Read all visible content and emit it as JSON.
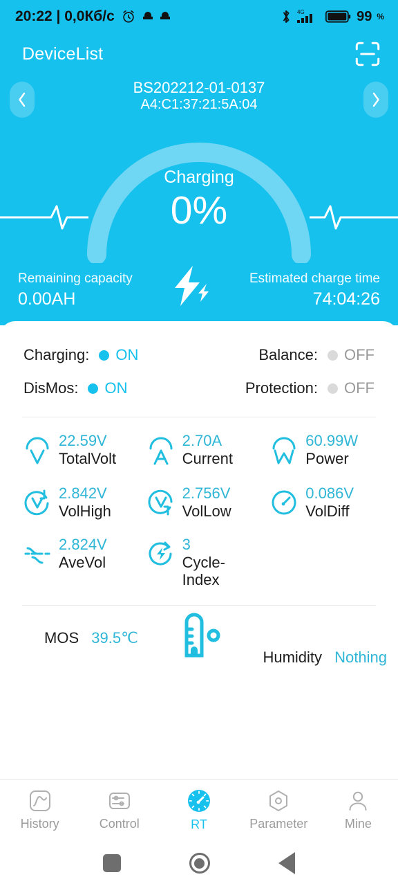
{
  "statusbar": {
    "clock": "20:22 | 0,0Кб/c",
    "alarm_icon": "alarm-clock-icon",
    "app_icon_1": "app-icon",
    "app_icon_2": "app-icon",
    "bluetooth_icon": "bluetooth-icon",
    "network_type": "4G",
    "signal_icon": "cellular-signal-icon",
    "battery_icon": "battery-icon",
    "battery_level": "99",
    "battery_unit": "%"
  },
  "appbar": {
    "title": "DeviceList",
    "scan_icon": "scan-code-icon"
  },
  "device": {
    "id": "BS202212-01-0137",
    "mac": "A4:C1:37:21:5A:04",
    "prev_icon": "chevron-left-icon",
    "next_icon": "chevron-right-icon"
  },
  "gauge": {
    "state": "Charging",
    "percent": "0%",
    "percent_value": 0,
    "ecg_icon": "ecg-line-icon"
  },
  "capacity": {
    "remaining_label": "Remaining capacity",
    "remaining_value": "0.00AH",
    "bolt_icon": "lightning-bolt-icon",
    "eta_label": "Estimated charge time",
    "eta_value": "74:04:26"
  },
  "switches": [
    {
      "label": "Charging:",
      "value": "ON",
      "state": "on"
    },
    {
      "label": "Balance:",
      "value": "OFF",
      "state": "off"
    },
    {
      "label": "DisMos:",
      "value": "ON",
      "state": "on"
    },
    {
      "label": "Protection:",
      "value": "OFF",
      "state": "off"
    }
  ],
  "metrics": [
    {
      "value": "22.59V",
      "label": "TotalVolt",
      "icon": "volt-meter-icon"
    },
    {
      "value": "2.70A",
      "label": "Current",
      "icon": "ampere-meter-icon"
    },
    {
      "value": "60.99W",
      "label": "Power",
      "icon": "watt-meter-icon"
    },
    {
      "value": "2.842V",
      "label": "VolHigh",
      "icon": "voltage-high-icon"
    },
    {
      "value": "2.756V",
      "label": "VolLow",
      "icon": "voltage-low-icon"
    },
    {
      "value": "0.086V",
      "label": "VolDiff",
      "icon": "voltage-diff-gauge-icon"
    },
    {
      "value": "2.824V",
      "label": "AveVol",
      "icon": "average-voltage-icon"
    },
    {
      "value": "3",
      "label": "Cycle-Index",
      "icon": "cycle-index-icon"
    }
  ],
  "temperature": {
    "mos_label": "MOS",
    "mos_value": "39.5℃",
    "thermometer_icon": "thermometer-icon",
    "humidity_label": "Humidity",
    "humidity_value": "Nothing"
  },
  "tabs": [
    {
      "label": "History",
      "icon": "history-chart-icon",
      "active": false
    },
    {
      "label": "Control",
      "icon": "sliders-icon",
      "active": false
    },
    {
      "label": "RT",
      "icon": "realtime-gauge-icon",
      "active": true
    },
    {
      "label": "Parameter",
      "icon": "hexagon-settings-icon",
      "active": false
    },
    {
      "label": "Mine",
      "icon": "user-icon",
      "active": false
    }
  ],
  "androidnav": {
    "recents_icon": "recents-square-icon",
    "home_icon": "home-circle-icon",
    "back_icon": "back-triangle-icon"
  },
  "colors": {
    "brand": "#17C1EE",
    "accent_text": "#2FB6D6",
    "off_grey": "#9a9a9a"
  }
}
